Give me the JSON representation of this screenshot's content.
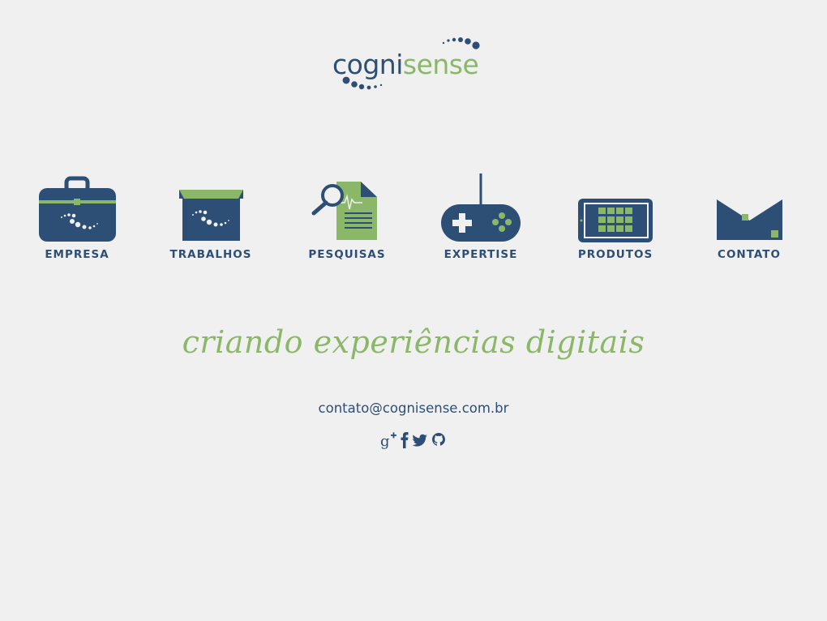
{
  "logo": {
    "part1": "co",
    "part2": "gni",
    "part3": "sense",
    "colors": {
      "blue": "#2d4f76",
      "green": "#8ab868"
    }
  },
  "nav": [
    {
      "id": "empresa",
      "label": "EMPRESA",
      "icon": "briefcase-icon"
    },
    {
      "id": "trabalhos",
      "label": "TRABALHOS",
      "icon": "box-icon"
    },
    {
      "id": "pesquisas",
      "label": "PESQUISAS",
      "icon": "document-search-icon"
    },
    {
      "id": "expertise",
      "label": "EXPERTISE",
      "icon": "gamepad-icon"
    },
    {
      "id": "produtos",
      "label": "PRODUTOS",
      "icon": "tablet-icon"
    },
    {
      "id": "contato",
      "label": "CONTATO",
      "icon": "envelope-icon"
    }
  ],
  "tagline": "criando experiências digitais",
  "email": "contato@cognisense.com.br",
  "social": [
    {
      "name": "google-plus-icon"
    },
    {
      "name": "facebook-icon"
    },
    {
      "name": "twitter-icon"
    },
    {
      "name": "github-icon"
    }
  ],
  "colors": {
    "background": "#f0f0f0",
    "primary": "#2d4f76",
    "accent": "#8ab868"
  }
}
